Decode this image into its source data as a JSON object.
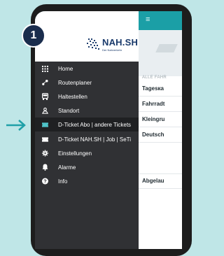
{
  "badge": "1",
  "arrow_color": "#1fa0a8",
  "appbar": {
    "menu_icon": "≡",
    "color": "#1b9fa6"
  },
  "content": {
    "section_label": "ALLE FAHR",
    "tickets": [
      "Tagesка",
      "Fahrradt",
      "Kleingru",
      "Deutsch"
    ],
    "subscription": "Abgelau"
  },
  "drawer": {
    "logo_text": "NAH.SH",
    "logo_sub": "Der Nahverkehr",
    "items": [
      {
        "label": "Home",
        "icon": "grid-icon"
      },
      {
        "label": "Routenplaner",
        "icon": "route-icon"
      },
      {
        "label": "Haltestellen",
        "icon": "bus-stop-icon"
      },
      {
        "label": "Standort",
        "icon": "location-person-icon"
      },
      {
        "label": "D-Ticket Abo | andere Tickets",
        "icon": "ticket-icon"
      },
      {
        "label": "D-Ticket NAH.SH | Job | SeTi",
        "icon": "ticket-icon"
      },
      {
        "label": "Einstellungen",
        "icon": "gear-icon"
      },
      {
        "label": "Alarme",
        "icon": "bell-icon"
      },
      {
        "label": "Info",
        "icon": "help-icon"
      }
    ]
  }
}
